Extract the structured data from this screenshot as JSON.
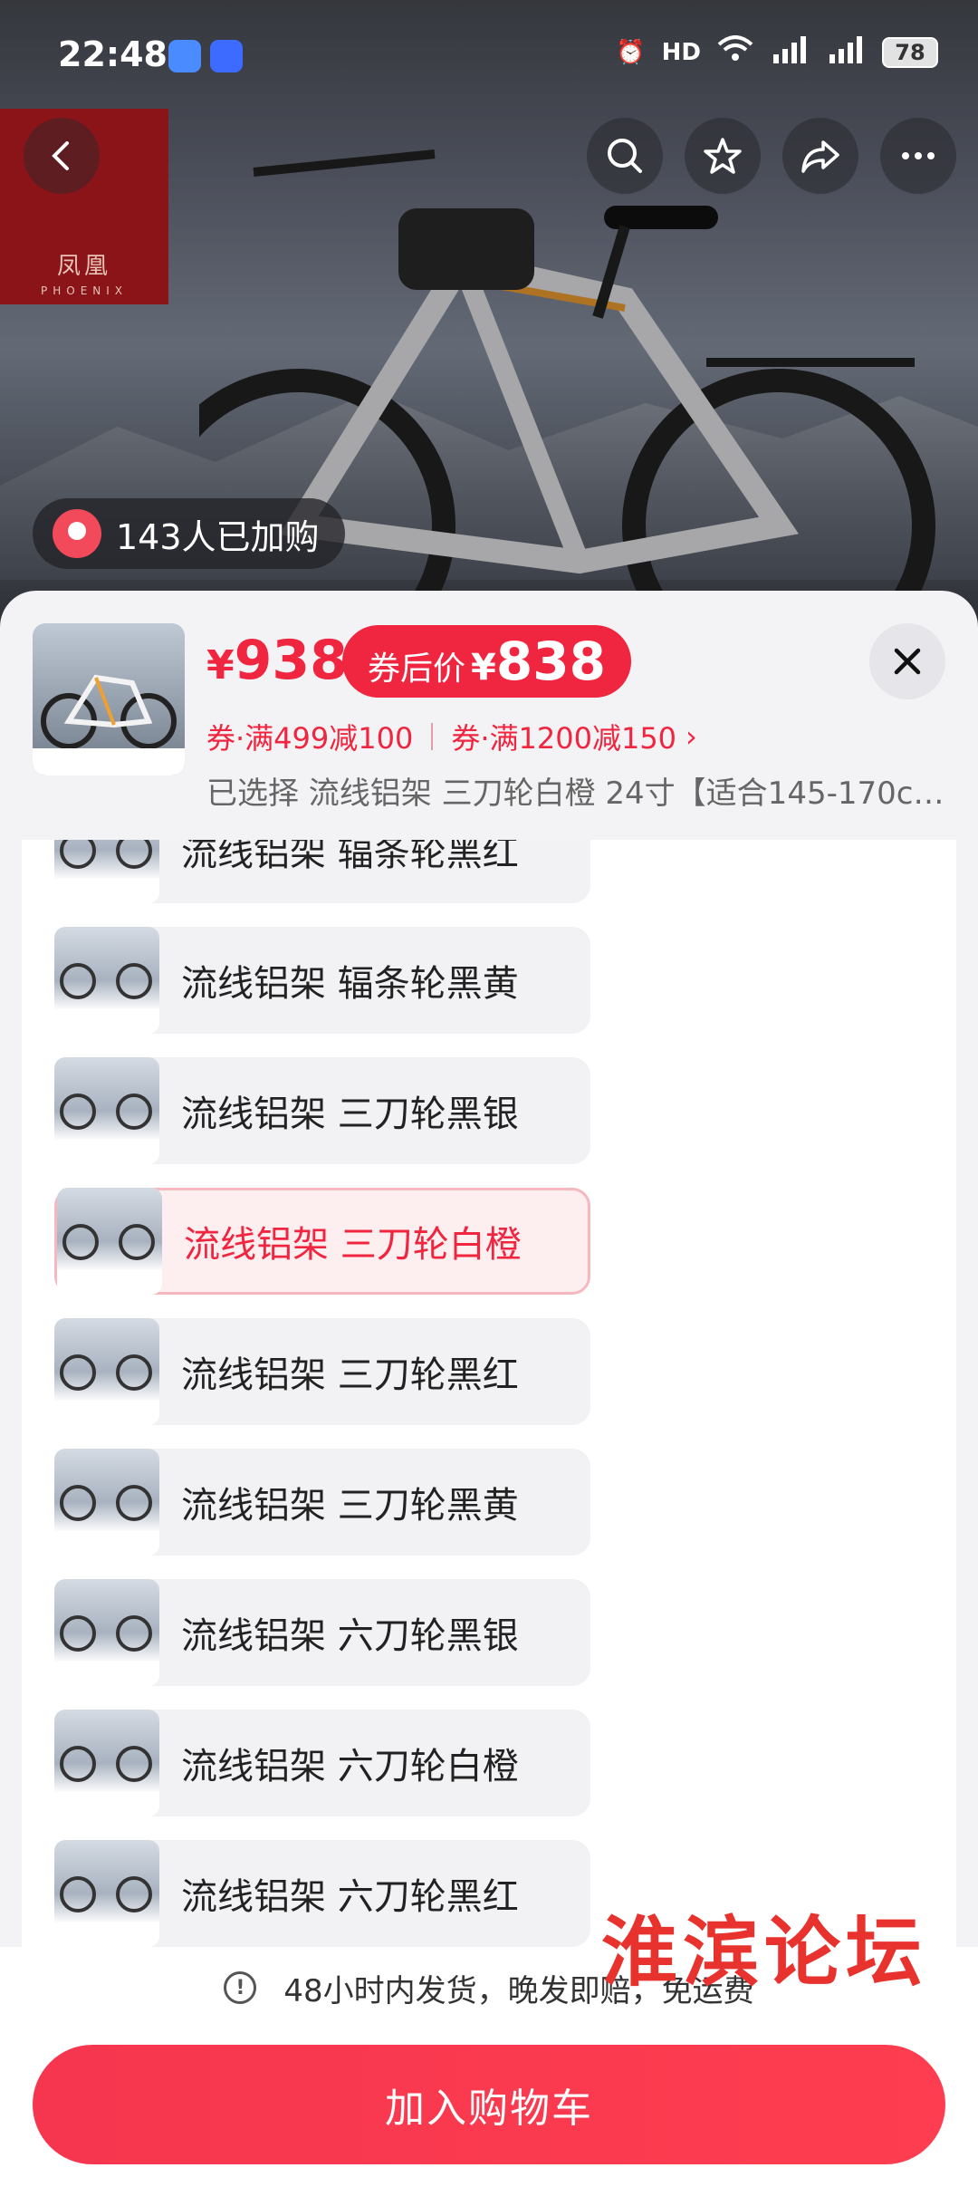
{
  "status_bar": {
    "time": "22:48",
    "battery": "78"
  },
  "hero": {
    "brand_logo_text": "凤凰",
    "brand_logo_sub": "PHOENIX",
    "buyers_text": "143人已加购"
  },
  "product": {
    "price_symbol": "¥",
    "price": "938",
    "after_coupon_label": "券后价",
    "after_coupon_symbol": "¥",
    "after_coupon_price": "838",
    "coupon1": "券·满499减100",
    "coupon2": "券·满1200减150",
    "coupon2_arrow": "›",
    "selected_text": "已选择 流线铝架 三刀轮白橙 24寸【适合145-170c…"
  },
  "options": [
    {
      "label": "流线铝架 辐条轮黑红",
      "selected": false
    },
    {
      "label": "流线铝架 辐条轮黑黄",
      "selected": false
    },
    {
      "label": "流线铝架 三刀轮黑银",
      "selected": false
    },
    {
      "label": "流线铝架 三刀轮白橙",
      "selected": true
    },
    {
      "label": "流线铝架 三刀轮黑红",
      "selected": false
    },
    {
      "label": "流线铝架 三刀轮黑黄",
      "selected": false
    },
    {
      "label": "流线铝架 六刀轮黑银",
      "selected": false
    },
    {
      "label": "流线铝架 六刀轮白橙",
      "selected": false
    },
    {
      "label": "流线铝架 六刀轮黑红",
      "selected": false
    }
  ],
  "notice": {
    "text": "48小时内发货，晚发即赔，免运费",
    "icon": "!"
  },
  "cart_button": "加入购物车",
  "watermark": "淮滨论坛",
  "colors": {
    "accent": "#f0253f",
    "selected_bg": "#fdeeef"
  }
}
